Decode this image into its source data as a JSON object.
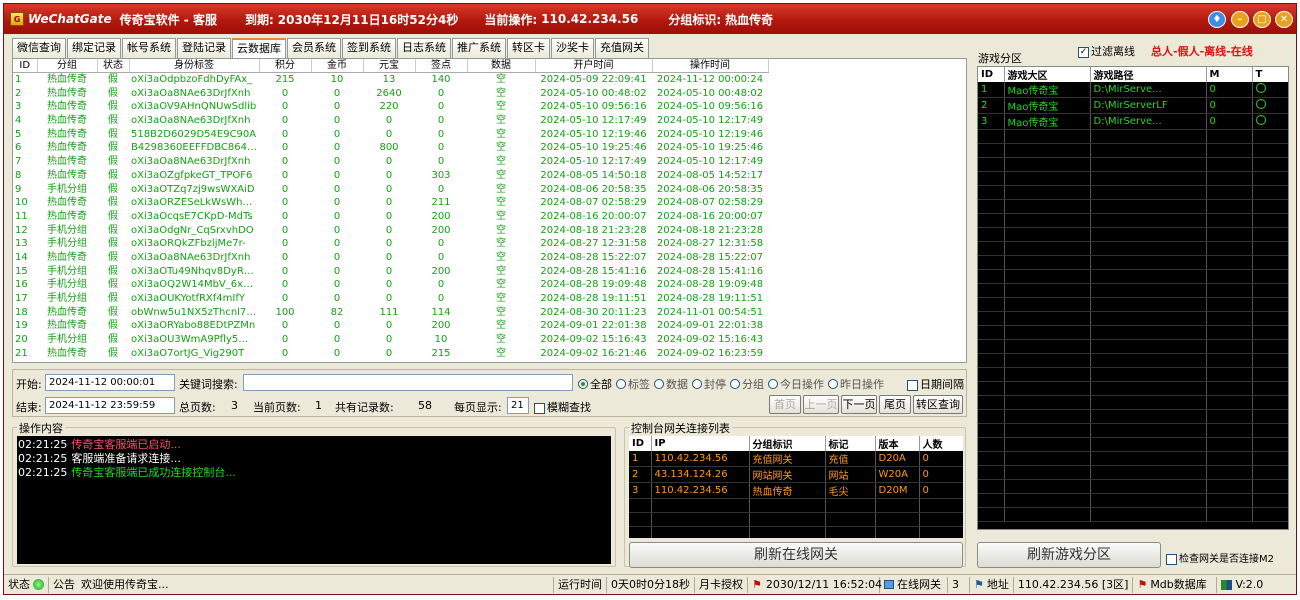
{
  "title": {
    "app": "WeChatGate",
    "name": "传奇宝软件 - 客服",
    "expire_label": "到期:",
    "expire": "2030年12月11日16时52分4秒",
    "current_op_label": "当前操作:",
    "current_op": "110.42.234.56",
    "group_label": "分组标识:",
    "group": "热血传奇"
  },
  "tabs": [
    "微信查询",
    "绑定记录",
    "帐号系统",
    "登陆记录",
    "云数据库",
    "会员系统",
    "签到系统",
    "日志系统",
    "推广系统",
    "转区卡",
    "沙奖卡",
    "充值网关"
  ],
  "active_tab": 4,
  "grid": {
    "columns": [
      "ID",
      "分组",
      "状态",
      "身份标签",
      "积分",
      "金币",
      "元宝",
      "签点",
      "数据",
      "开户时间",
      "操作时间"
    ],
    "rows": [
      [
        "1",
        "热血传奇",
        "假",
        "oXi3aOdpbzoFdhDyFAx_",
        "215",
        "10",
        "13",
        "140",
        "空",
        "2024-05-09 22:09:41",
        "2024-11-12 00:00:24"
      ],
      [
        "2",
        "热血传奇",
        "假",
        "oXi3aOa8NAe63DrJfXnh",
        "0",
        "0",
        "2640",
        "0",
        "空",
        "2024-05-10 00:48:02",
        "2024-05-10 00:48:02"
      ],
      [
        "3",
        "热血传奇",
        "假",
        "oXi3aOV9AHnQNUwSdlib",
        "0",
        "0",
        "220",
        "0",
        "空",
        "2024-05-10 09:56:16",
        "2024-05-10 09:56:16"
      ],
      [
        "4",
        "热血传奇",
        "假",
        "oXi3aOa8NAe63DrJfXnh",
        "0",
        "0",
        "0",
        "0",
        "空",
        "2024-05-10 12:17:49",
        "2024-05-10 12:17:49"
      ],
      [
        "5",
        "热血传奇",
        "假",
        "518B2D6029D54E9C90A",
        "0",
        "0",
        "0",
        "0",
        "空",
        "2024-05-10 12:19:46",
        "2024-05-10 12:19:46"
      ],
      [
        "6",
        "热血传奇",
        "假",
        "B4298360EEFFDBC86483",
        "0",
        "0",
        "800",
        "0",
        "空",
        "2024-05-10 19:25:46",
        "2024-05-10 19:25:46"
      ],
      [
        "7",
        "热血传奇",
        "假",
        "oXi3aOa8NAe63DrJfXnh",
        "0",
        "0",
        "0",
        "0",
        "空",
        "2024-05-10 12:17:49",
        "2024-05-10 12:17:49"
      ],
      [
        "8",
        "热血传奇",
        "假",
        "oXi3aOZgfpkeGT_TPOF6",
        "0",
        "0",
        "0",
        "303",
        "空",
        "2024-08-05 14:50:18",
        "2024-08-05 14:52:17"
      ],
      [
        "9",
        "手机分组",
        "假",
        "oXi3aOTZq7zj9wsWXAiD",
        "0",
        "0",
        "0",
        "0",
        "空",
        "2024-08-06 20:58:35",
        "2024-08-06 20:58:35"
      ],
      [
        "10",
        "热血传奇",
        "假",
        "oXi3aORZESeLkWsWh_N3",
        "0",
        "0",
        "0",
        "211",
        "空",
        "2024-08-07 02:58:29",
        "2024-08-07 02:58:29"
      ],
      [
        "11",
        "热血传奇",
        "假",
        "oXi3aOcqsE7CKpD-MdTs",
        "0",
        "0",
        "0",
        "200",
        "空",
        "2024-08-16 20:00:07",
        "2024-08-16 20:00:07"
      ],
      [
        "12",
        "手机分组",
        "假",
        "oXi3aOdgNr_CqSrxvhDO",
        "0",
        "0",
        "0",
        "200",
        "空",
        "2024-08-18 21:23:28",
        "2024-08-18 21:23:28"
      ],
      [
        "13",
        "手机分组",
        "假",
        "oXi3aORQkZFbzljMe7r-",
        "0",
        "0",
        "0",
        "0",
        "空",
        "2024-08-27 12:31:58",
        "2024-08-27 12:31:58"
      ],
      [
        "14",
        "热血传奇",
        "假",
        "oXi3aOa8NAe63DrJfXnh",
        "0",
        "0",
        "0",
        "0",
        "空",
        "2024-08-28 15:22:07",
        "2024-08-28 15:22:07"
      ],
      [
        "15",
        "手机分组",
        "假",
        "oXi3aOTu49Nhqv8DyROY",
        "0",
        "0",
        "0",
        "200",
        "空",
        "2024-08-28 15:41:16",
        "2024-08-28 15:41:16"
      ],
      [
        "16",
        "手机分组",
        "假",
        "oXi3aOQ2W14MbV_6xh82",
        "0",
        "0",
        "0",
        "0",
        "空",
        "2024-08-28 19:09:48",
        "2024-08-28 19:09:48"
      ],
      [
        "17",
        "手机分组",
        "假",
        "oXi3aOUKYotfRXf4mIfY",
        "0",
        "0",
        "0",
        "0",
        "空",
        "2024-08-28 19:11:51",
        "2024-08-28 19:11:51"
      ],
      [
        "18",
        "热血传奇",
        "假",
        "obWnw5u1NX5zThcnl7Tw",
        "100",
        "82",
        "111",
        "114",
        "空",
        "2024-08-30 20:11:23",
        "2024-11-01 00:54:51"
      ],
      [
        "19",
        "热血传奇",
        "假",
        "oXi3aORYabo88EDtPZMn",
        "0",
        "0",
        "0",
        "200",
        "空",
        "2024-09-01 22:01:38",
        "2024-09-01 22:01:38"
      ],
      [
        "20",
        "手机分组",
        "假",
        "oXi3aOU3WmA9Pfly5Wz9",
        "0",
        "0",
        "0",
        "10",
        "空",
        "2024-09-02 15:16:43",
        "2024-09-02 15:16:43"
      ],
      [
        "21",
        "热血传奇",
        "假",
        "oXi3aO7ortJG_Vig290T",
        "0",
        "0",
        "0",
        "215",
        "空",
        "2024-09-02 16:21:46",
        "2024-09-02 16:23:59"
      ]
    ]
  },
  "search": {
    "start_label": "开始:",
    "start": "2024-11-12 00:00:01",
    "keyword_label": "关键词搜索:",
    "keyword": "",
    "end_label": "结束:",
    "end": "2024-11-12 23:59:59",
    "radios": [
      "全部",
      "标签",
      "数据",
      "封停",
      "分组",
      "今日操作",
      "昨日操作"
    ],
    "radio_selected": 0,
    "date_interval": "日期间隔",
    "total_pages_label": "总页数:",
    "total_pages": "3",
    "cur_page_label": "当前页数:",
    "cur_page": "1",
    "records_label": "共有记录数:",
    "records": "58",
    "per_page_label": "每页显示:",
    "per_page": "21",
    "fuzzy": "模糊查找",
    "buttons": [
      "首页",
      "上一页",
      "下一页",
      "尾页",
      "转区查询"
    ]
  },
  "log": {
    "title": "操作内容",
    "lines": [
      {
        "time": "02:21:25",
        "text": "传奇宝客服端已启动...",
        "color": "#ff4d6d"
      },
      {
        "time": "02:21:25",
        "text": "客服端准备请求连接...",
        "color": "#ffffff"
      },
      {
        "time": "02:21:25",
        "text": "传奇宝客服端已成功连接控制台...",
        "color": "#22d822"
      }
    ]
  },
  "gateway": {
    "title": "控制台网关连接列表",
    "columns": [
      "ID",
      "IP",
      "分组标识",
      "标记",
      "版本",
      "人数"
    ],
    "rows": [
      [
        "1",
        "110.42.234.56",
        "充值网关",
        "充值",
        "D20A",
        "0"
      ],
      [
        "2",
        "43.134.124.26",
        "网站网关",
        "网站",
        "W20A",
        "0"
      ],
      [
        "3",
        "110.42.234.56",
        "热血传奇",
        "毛尖",
        "D20M",
        "0"
      ]
    ],
    "refresh": "刷新在线网关"
  },
  "zones": {
    "title": "游戏分区",
    "filter": "过滤离线",
    "legend": "总人-假人-离线-在线",
    "columns": [
      "ID",
      "游戏大区",
      "游戏路径",
      "M",
      "T"
    ],
    "rows": [
      [
        "1",
        "Mao传奇宝",
        "D:\\MirServe...",
        "0"
      ],
      [
        "2",
        "Mao传奇宝",
        "D:\\MirServerLF",
        "0"
      ],
      [
        "3",
        "Mao传奇宝",
        "D:\\MirServe...",
        "0"
      ]
    ],
    "refresh": "刷新游戏分区",
    "check": "检查网关是否连接M2"
  },
  "status": {
    "state": "状态",
    "notice_label": "公告",
    "notice": "欢迎使用传奇宝...",
    "run_label": "运行时间",
    "run": "0天0时0分18秒",
    "license": "月卡授权",
    "datetime": "2030/12/11 16:52:04",
    "online_gw": "在线网关",
    "online_count": "3",
    "addr_label": "地址",
    "addr": "110.42.234.56 [3区]",
    "db": "Mdb数据库",
    "version": "V:2.0"
  }
}
